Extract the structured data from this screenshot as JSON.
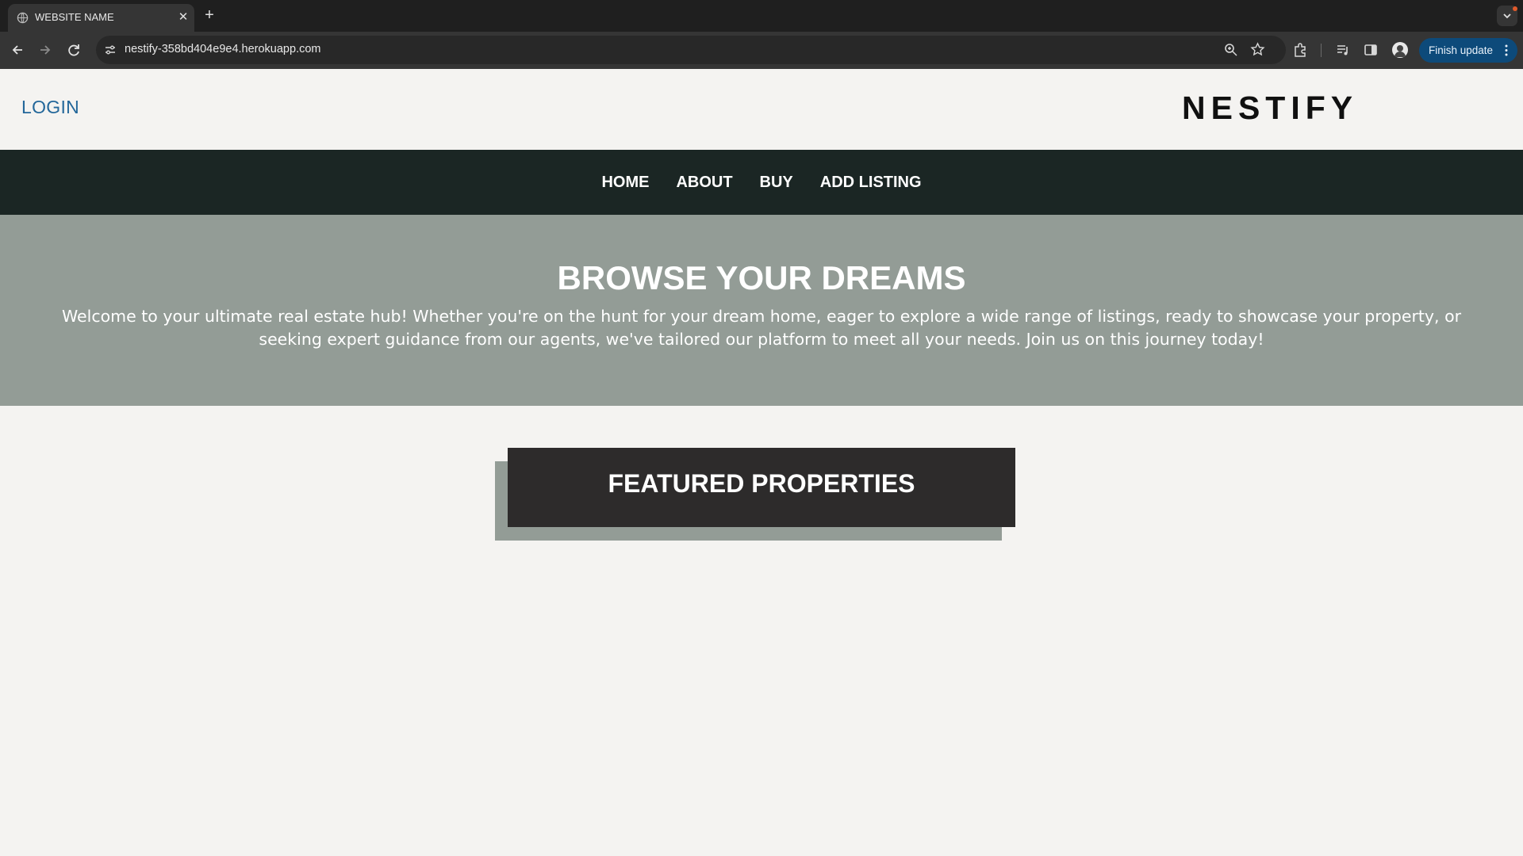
{
  "browser": {
    "tab_title": "WEBSITE NAME",
    "url": "nestify-358bd404e9e4.herokuapp.com",
    "update_button": "Finish update"
  },
  "header": {
    "login": "LOGIN",
    "brand": "NESTIFY"
  },
  "nav": {
    "items": [
      "HOME",
      "ABOUT",
      "BUY",
      "ADD LISTING"
    ]
  },
  "hero": {
    "title": "BROWSE YOUR DREAMS",
    "text": "Welcome to your ultimate real estate hub! Whether you're on the hunt for your dream home, eager to explore a wide range of listings, ready to showcase your property, or seeking expert guidance from our agents, we've tailored our platform to meet all your needs. Join us on this journey today!"
  },
  "featured": {
    "title": "FEATURED PROPERTIES"
  },
  "colors": {
    "nav_bg": "#1b2624",
    "hero_bg": "#939c96",
    "featured_bg": "#2d2b2b",
    "login_link": "#23679a",
    "update_button_bg": "#0d4a7a"
  }
}
